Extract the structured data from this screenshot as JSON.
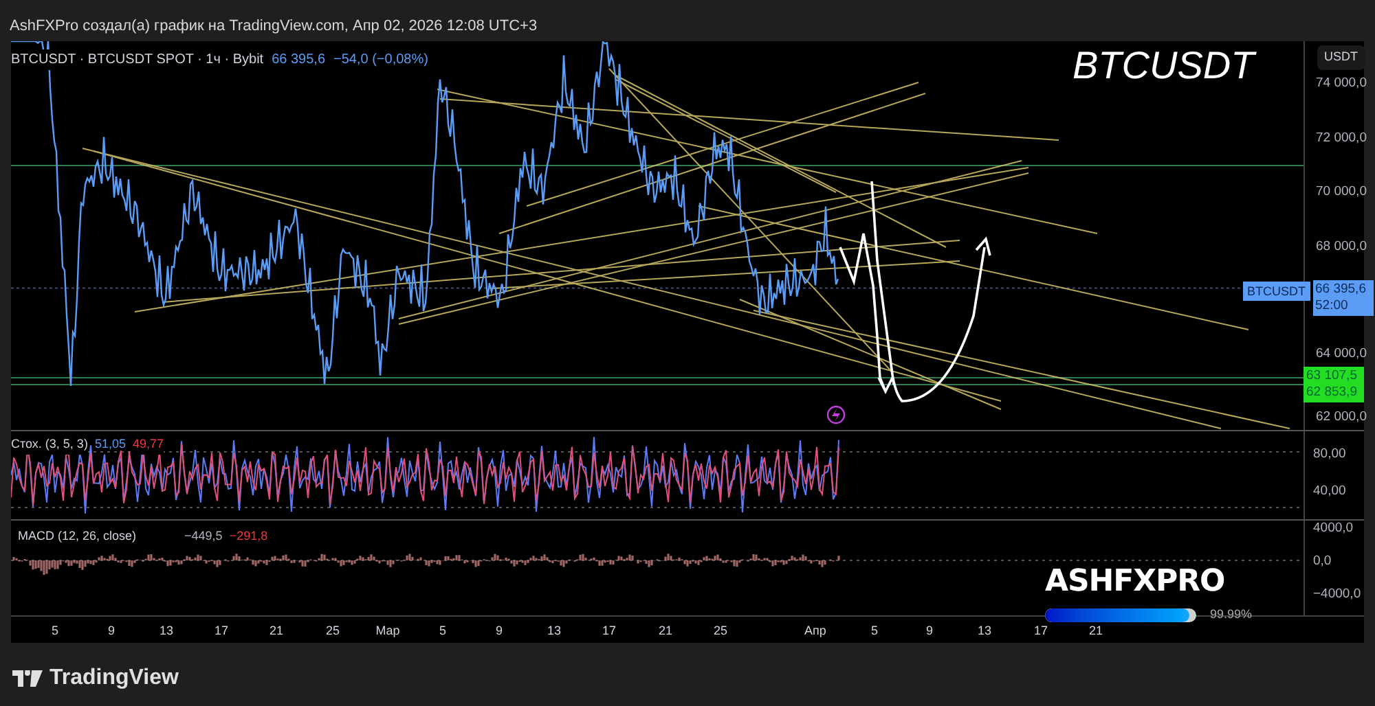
{
  "header": {
    "text": "AshFXPro создал(а) график на TradingView.com, Апр 02, 2026 12:08 UTC+3"
  },
  "legend": {
    "symbol": "BTCUSDT · BTCUSDT SPOT · 1ч · Bybit",
    "price": "66 395,6",
    "change": "−54,0 (−0,08%)"
  },
  "chart_title": "BTCUSDT",
  "price_axis": {
    "currency_button": "USDT",
    "labels": [
      "74 000,0",
      "72 000,0",
      "70 000,0",
      "68 000,0",
      "64 000,0",
      "62 000,0"
    ],
    "last_price_tag": {
      "symbol": "BTCUSDT",
      "price": "66 395,6",
      "countdown": "52:00"
    },
    "level_tags": [
      "63 107,5",
      "62 853,9"
    ]
  },
  "stochastic": {
    "label": "Стох. (3, 5, 3)",
    "k": "51,05",
    "d": "49,77",
    "axis": [
      "80,00",
      "40,00"
    ]
  },
  "macd": {
    "label": "MACD (12, 26, close)",
    "macd": "−449,5",
    "signal": "−291,8",
    "axis": [
      "4000,0",
      "0,0",
      "−4000,0"
    ]
  },
  "time_axis": [
    "5",
    "9",
    "13",
    "17",
    "21",
    "25",
    "Мар",
    "5",
    "9",
    "13",
    "17",
    "21",
    "25",
    "Апр",
    "5",
    "9",
    "13",
    "17",
    "21"
  ],
  "badge": {
    "text": "ASHFXPRO",
    "level": 0.95,
    "reading": "99.99%"
  },
  "footer": {
    "brand": "TradingView"
  }
}
